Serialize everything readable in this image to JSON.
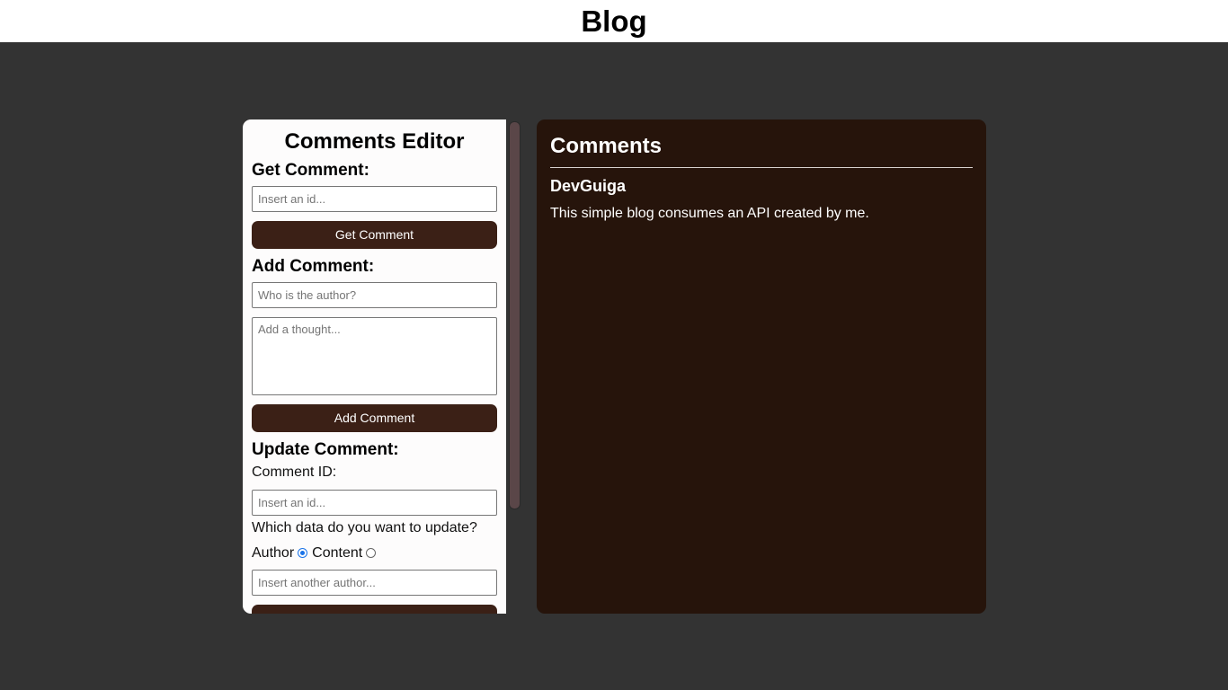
{
  "header": {
    "title": "Blog"
  },
  "editor": {
    "title": "Comments Editor",
    "get": {
      "heading": "Get Comment:",
      "id_placeholder": "Insert an id...",
      "button_label": "Get Comment"
    },
    "add": {
      "heading": "Add Comment:",
      "author_placeholder": "Who is the author?",
      "content_placeholder": "Add a thought...",
      "button_label": "Add Comment"
    },
    "update": {
      "heading": "Update Comment:",
      "id_label": "Comment ID:",
      "id_placeholder": "Insert an id...",
      "question": "Which data do you want to update?",
      "option_author": "Author",
      "option_content": "Content",
      "selected": "Author",
      "value_placeholder": "Insert another author..."
    }
  },
  "comments": {
    "title": "Comments",
    "items": [
      {
        "author": "DevGuiga",
        "content": "This simple blog consumes an API created by me."
      }
    ]
  },
  "colors": {
    "page_bg": "#333333",
    "button_bg": "#3b2016",
    "comments_panel_bg": "#26140b",
    "radio_selected": "#1a73e8"
  }
}
